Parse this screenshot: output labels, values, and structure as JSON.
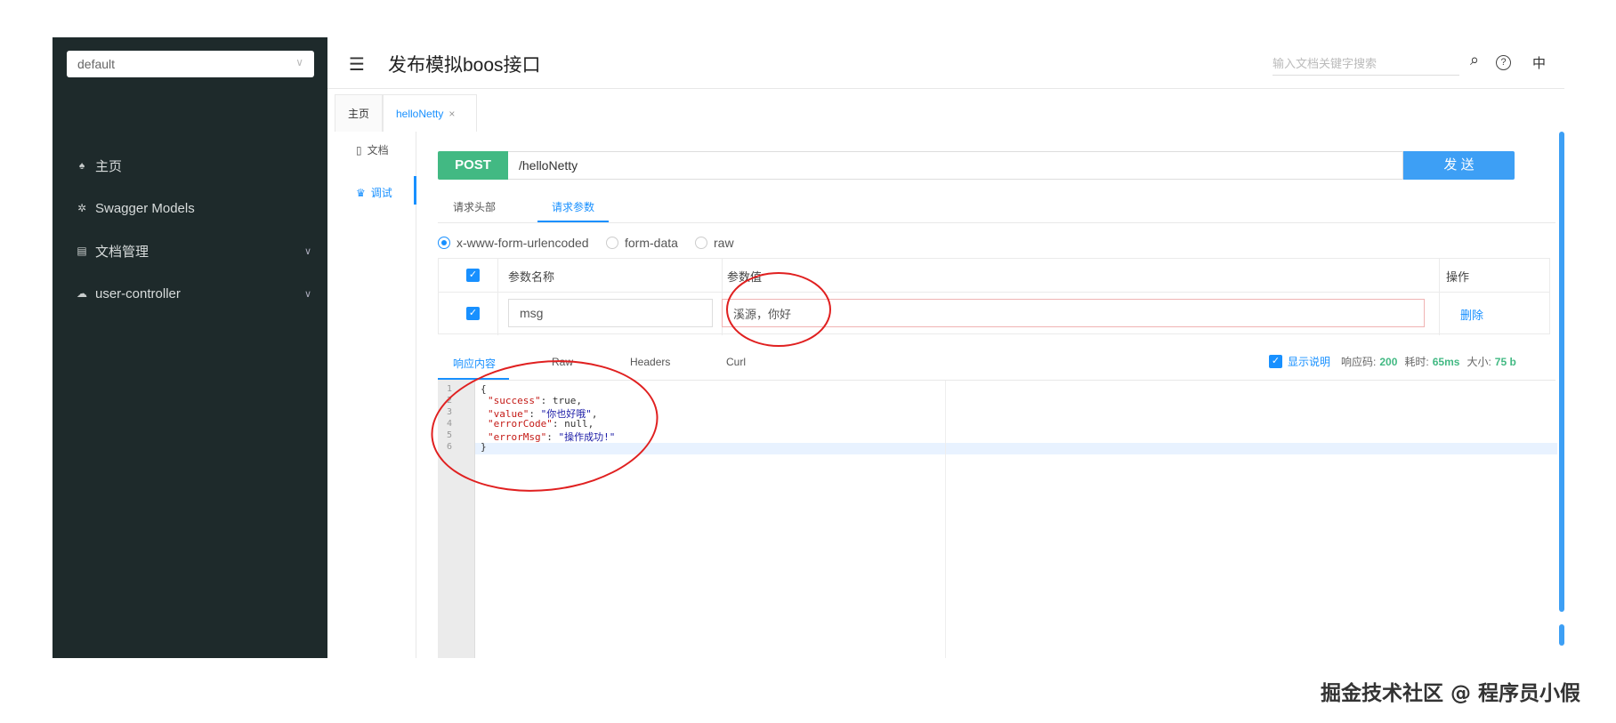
{
  "sidebar": {
    "group_select": "default",
    "items": [
      {
        "label": "主页",
        "icon": "home-icon",
        "has_chevron": false
      },
      {
        "label": "Swagger Models",
        "icon": "gear-icon",
        "has_chevron": false
      },
      {
        "label": "文档管理",
        "icon": "document-manage-icon",
        "has_chevron": true
      },
      {
        "label": "user-controller",
        "icon": "cloud-icon",
        "has_chevron": true
      }
    ]
  },
  "header": {
    "title": "发布模拟boos接口",
    "search_placeholder": "输入文档关键字搜索",
    "help": "?",
    "lang": "中"
  },
  "tabs": [
    {
      "label": "主页",
      "active": false
    },
    {
      "label": "helloNetty",
      "active": true,
      "close": "×"
    }
  ],
  "mini_nav": [
    {
      "label": "文档",
      "active": false
    },
    {
      "label": "调试",
      "active": true
    }
  ],
  "request": {
    "method": "POST",
    "url": "/helloNetty",
    "send_label": "发 送"
  },
  "subtabs": [
    {
      "label": "请求头部",
      "active": false
    },
    {
      "label": "请求参数",
      "active": true
    }
  ],
  "body_types": [
    {
      "label": "x-www-form-urlencoded",
      "checked": true
    },
    {
      "label": "form-data",
      "checked": false
    },
    {
      "label": "raw",
      "checked": false
    }
  ],
  "params_table": {
    "headers": [
      "参数名称",
      "参数值",
      "操作"
    ],
    "rows": [
      {
        "name": "msg",
        "value": "溪源，你好",
        "action": "删除"
      }
    ]
  },
  "response": {
    "tabs": [
      {
        "label": "响应内容",
        "active": true
      },
      {
        "label": "Raw",
        "active": false
      },
      {
        "label": "Headers",
        "active": false
      },
      {
        "label": "Curl",
        "active": false
      }
    ],
    "show_desc_label": "显示说明",
    "status_label": "响应码:",
    "status_value": "200",
    "time_label": "耗时:",
    "time_value": "65ms",
    "size_label": "大小:",
    "size_value": "75 b",
    "code_lines": [
      {
        "n": "1",
        "text": "{"
      },
      {
        "n": "2",
        "key": "\"success\"",
        "rest": ": true,"
      },
      {
        "n": "3",
        "key": "\"value\"",
        "mid": ": ",
        "str": "\"你也好哦\"",
        "rest": ","
      },
      {
        "n": "4",
        "key": "\"errorCode\"",
        "rest": ": null,"
      },
      {
        "n": "5",
        "key": "\"errorMsg\"",
        "mid": ": ",
        "str": "\"操作成功!\""
      },
      {
        "n": "6",
        "text": "}"
      }
    ]
  },
  "watermark": "掘金技术社区 @ 程序员小假",
  "colors": {
    "sidebar_bg": "#1e2a2b",
    "accent": "#1890ff",
    "post_green": "#42b983",
    "send_blue": "#3d9ff5",
    "annotation_red": "#e02020"
  }
}
